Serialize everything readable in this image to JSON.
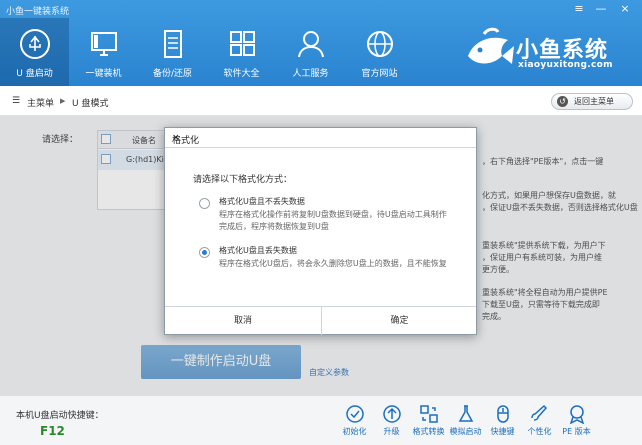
{
  "window": {
    "title": "小鱼一键装系统",
    "menu_glyph": "≡",
    "minimize_glyph": "—",
    "close_glyph": "×"
  },
  "nav": {
    "items": [
      {
        "label": "U 盘启动",
        "icon": "usb-icon",
        "active": true
      },
      {
        "label": "一键装机",
        "icon": "monitor-icon",
        "active": false
      },
      {
        "label": "备份/还原",
        "icon": "document-icon",
        "active": false
      },
      {
        "label": "软件大全",
        "icon": "apps-grid-icon",
        "active": false
      },
      {
        "label": "人工服务",
        "icon": "person-icon",
        "active": false
      },
      {
        "label": "官方网站",
        "icon": "globe-icon",
        "active": false
      }
    ]
  },
  "brand": {
    "name": "小鱼系统",
    "url": "xiaoyuxitong.com"
  },
  "breadcrumb": {
    "menu_glyph": "☰",
    "home": "主菜单",
    "separator": "▶",
    "current": "U 盘模式",
    "back_button": "返回主菜单"
  },
  "main": {
    "select_label": "请选择：",
    "table": {
      "header_device": "设备名",
      "row_device": "G:(hd1)Ki"
    },
    "right_text": [
      "，右下角选择\"PE版本\"，点击一键",
      "化方式，如果用户想保存U盘数据，就",
      "，保证U盘不丢失数据，否则选择格式化U盘",
      "重装系统\"提供系统下载，为用户下",
      "，保证用户有系统可装，为用户维",
      "更方便。",
      "重装系统\"将全程自动为用户提供PE",
      "下载至U盘，只需等待下载完成即",
      "完成。"
    ],
    "make_button": "一键制作启动U盘",
    "custom_params": "自定义参数"
  },
  "bottom": {
    "hotkey_label": "本机U盘启动快捷键：",
    "hotkey": "F12",
    "tools": [
      {
        "label": "初始化",
        "icon": "check-circle-icon"
      },
      {
        "label": "升级",
        "icon": "upload-circle-icon"
      },
      {
        "label": "格式转换",
        "icon": "convert-icon"
      },
      {
        "label": "模拟启动",
        "icon": "flask-icon"
      },
      {
        "label": "快捷键",
        "icon": "mouse-icon"
      },
      {
        "label": "个性化",
        "icon": "brush-icon"
      },
      {
        "label": "PE 版本",
        "icon": "badge-icon"
      }
    ]
  },
  "dialog": {
    "title": "格式化",
    "close_glyph": "×",
    "prompt": "请选择以下格式化方式：",
    "options": [
      {
        "title": "格式化U盘且不丢失数据",
        "desc_line1": "程序在格式化操作前将复制U盘数据到硬盘，待U盘启动工具制作",
        "desc_line2": "完成后，程序将数据恢复到U盘",
        "selected": false
      },
      {
        "title": "格式化U盘且丢失数据",
        "desc_line1": "程序在格式化U盘后，将会永久删除您U盘上的数据，且不能恢复",
        "selected": true
      }
    ],
    "cancel": "取消",
    "confirm": "确定"
  },
  "colors": {
    "header_blue": "#2a83cf",
    "accent": "#2a7ad2",
    "hotkey_green": "#2a8a2a"
  }
}
